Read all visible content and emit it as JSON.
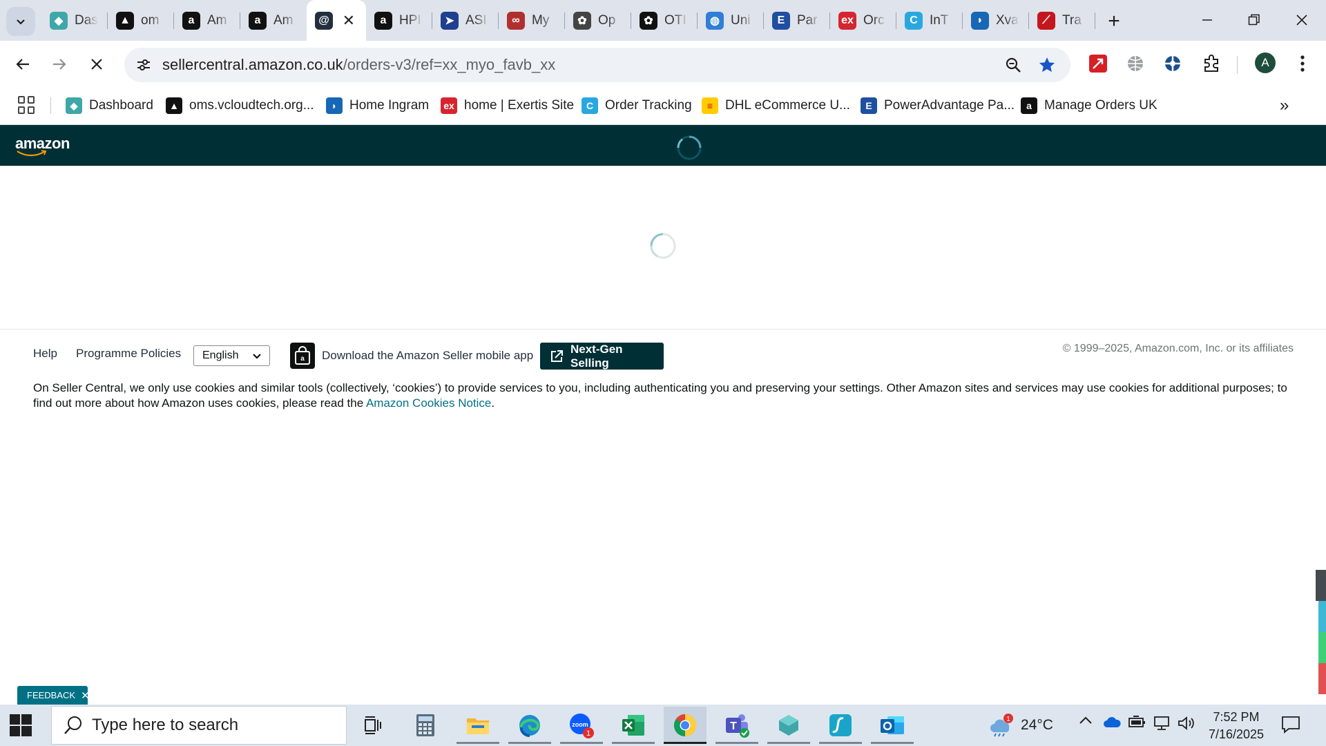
{
  "browser": {
    "tabs": [
      {
        "title": "Das",
        "icon": "dashboard-icon",
        "color": "#3fa7a8"
      },
      {
        "title": "om",
        "icon": "triangle-icon",
        "color": "#111111"
      },
      {
        "title": "Am",
        "icon": "amazon-icon",
        "color": "#111111"
      },
      {
        "title": "Am",
        "icon": "amazon-icon",
        "color": "#111111"
      },
      {
        "title": "",
        "icon": "amazon-smile-icon",
        "color": "#232f3e",
        "active": true
      },
      {
        "title": "HPI",
        "icon": "amazon-icon",
        "color": "#111111"
      },
      {
        "title": "ASI",
        "icon": "arrow-icon",
        "color": "#1f3f8f"
      },
      {
        "title": "My",
        "icon": "rings-icon",
        "color": "#b03030"
      },
      {
        "title": "Op",
        "icon": "openai-icon",
        "color": "#444444"
      },
      {
        "title": "OTI",
        "icon": "openai-icon",
        "color": "#111111"
      },
      {
        "title": "Uni",
        "icon": "globe-icon",
        "color": "#2f7fd8"
      },
      {
        "title": "Par",
        "icon": "e-letter-icon",
        "color": "#1f4fa0"
      },
      {
        "title": "Orc",
        "icon": "exertis-icon",
        "color": "#d5262f"
      },
      {
        "title": "InT",
        "icon": "c-swirl-icon",
        "color": "#29a8e0"
      },
      {
        "title": "Xva",
        "icon": "ingram-icon",
        "color": "#1667b5"
      },
      {
        "title": "Tra",
        "icon": "pdf-icon",
        "color": "#c4161c"
      }
    ],
    "url_host": "sellercentral.amazon.co.uk",
    "url_path": "/orders-v3/ref=xx_myo_favb_xx",
    "profile_initial": "A",
    "bookmarks": [
      {
        "label": "Dashboard",
        "icon": "dashboard-icon",
        "color": "#3fa7a8"
      },
      {
        "label": "oms.vcloudtech.org...",
        "icon": "triangle-icon",
        "color": "#111111"
      },
      {
        "label": "Home Ingram",
        "icon": "ingram-icon",
        "color": "#1667b5"
      },
      {
        "label": "home | Exertis Site",
        "icon": "exertis-icon",
        "color": "#d5262f"
      },
      {
        "label": "Order Tracking",
        "icon": "c-swirl-icon",
        "color": "#29a8e0"
      },
      {
        "label": "DHL eCommerce U...",
        "icon": "dhl-icon",
        "color": "#ffcc00"
      },
      {
        "label": "PowerAdvantage Pa...",
        "icon": "e-letter-icon",
        "color": "#1f4fa0"
      },
      {
        "label": "Manage Orders UK",
        "icon": "amazon-icon",
        "color": "#111111"
      }
    ]
  },
  "header": {
    "logo": "amazon"
  },
  "footer": {
    "help": "Help",
    "policies": "Programme Policies",
    "language": "English",
    "app_download": "Download the Amazon Seller mobile app",
    "next_gen": "Next-Gen Selling",
    "copyright": "© 1999–2025, Amazon.com, Inc. or its affiliates",
    "cookie_text": "On Seller Central, we only use cookies and similar tools (collectively, ‘cookies’) to provide services to you, including authenticating you and preserving your settings. Other Amazon sites and services may use cookies for additional purposes; to find out more about how Amazon uses cookies, please read the ",
    "cookie_link": "Amazon Cookies Notice",
    "cookie_end": "."
  },
  "feedback": {
    "label": "FEEDBACK"
  },
  "taskbar": {
    "search_placeholder": "Type here to search",
    "zoom_badge": "1",
    "weather_temp": "24°C",
    "weather_badge": "1",
    "time": "7:52 PM",
    "date": "7/16/2025"
  }
}
